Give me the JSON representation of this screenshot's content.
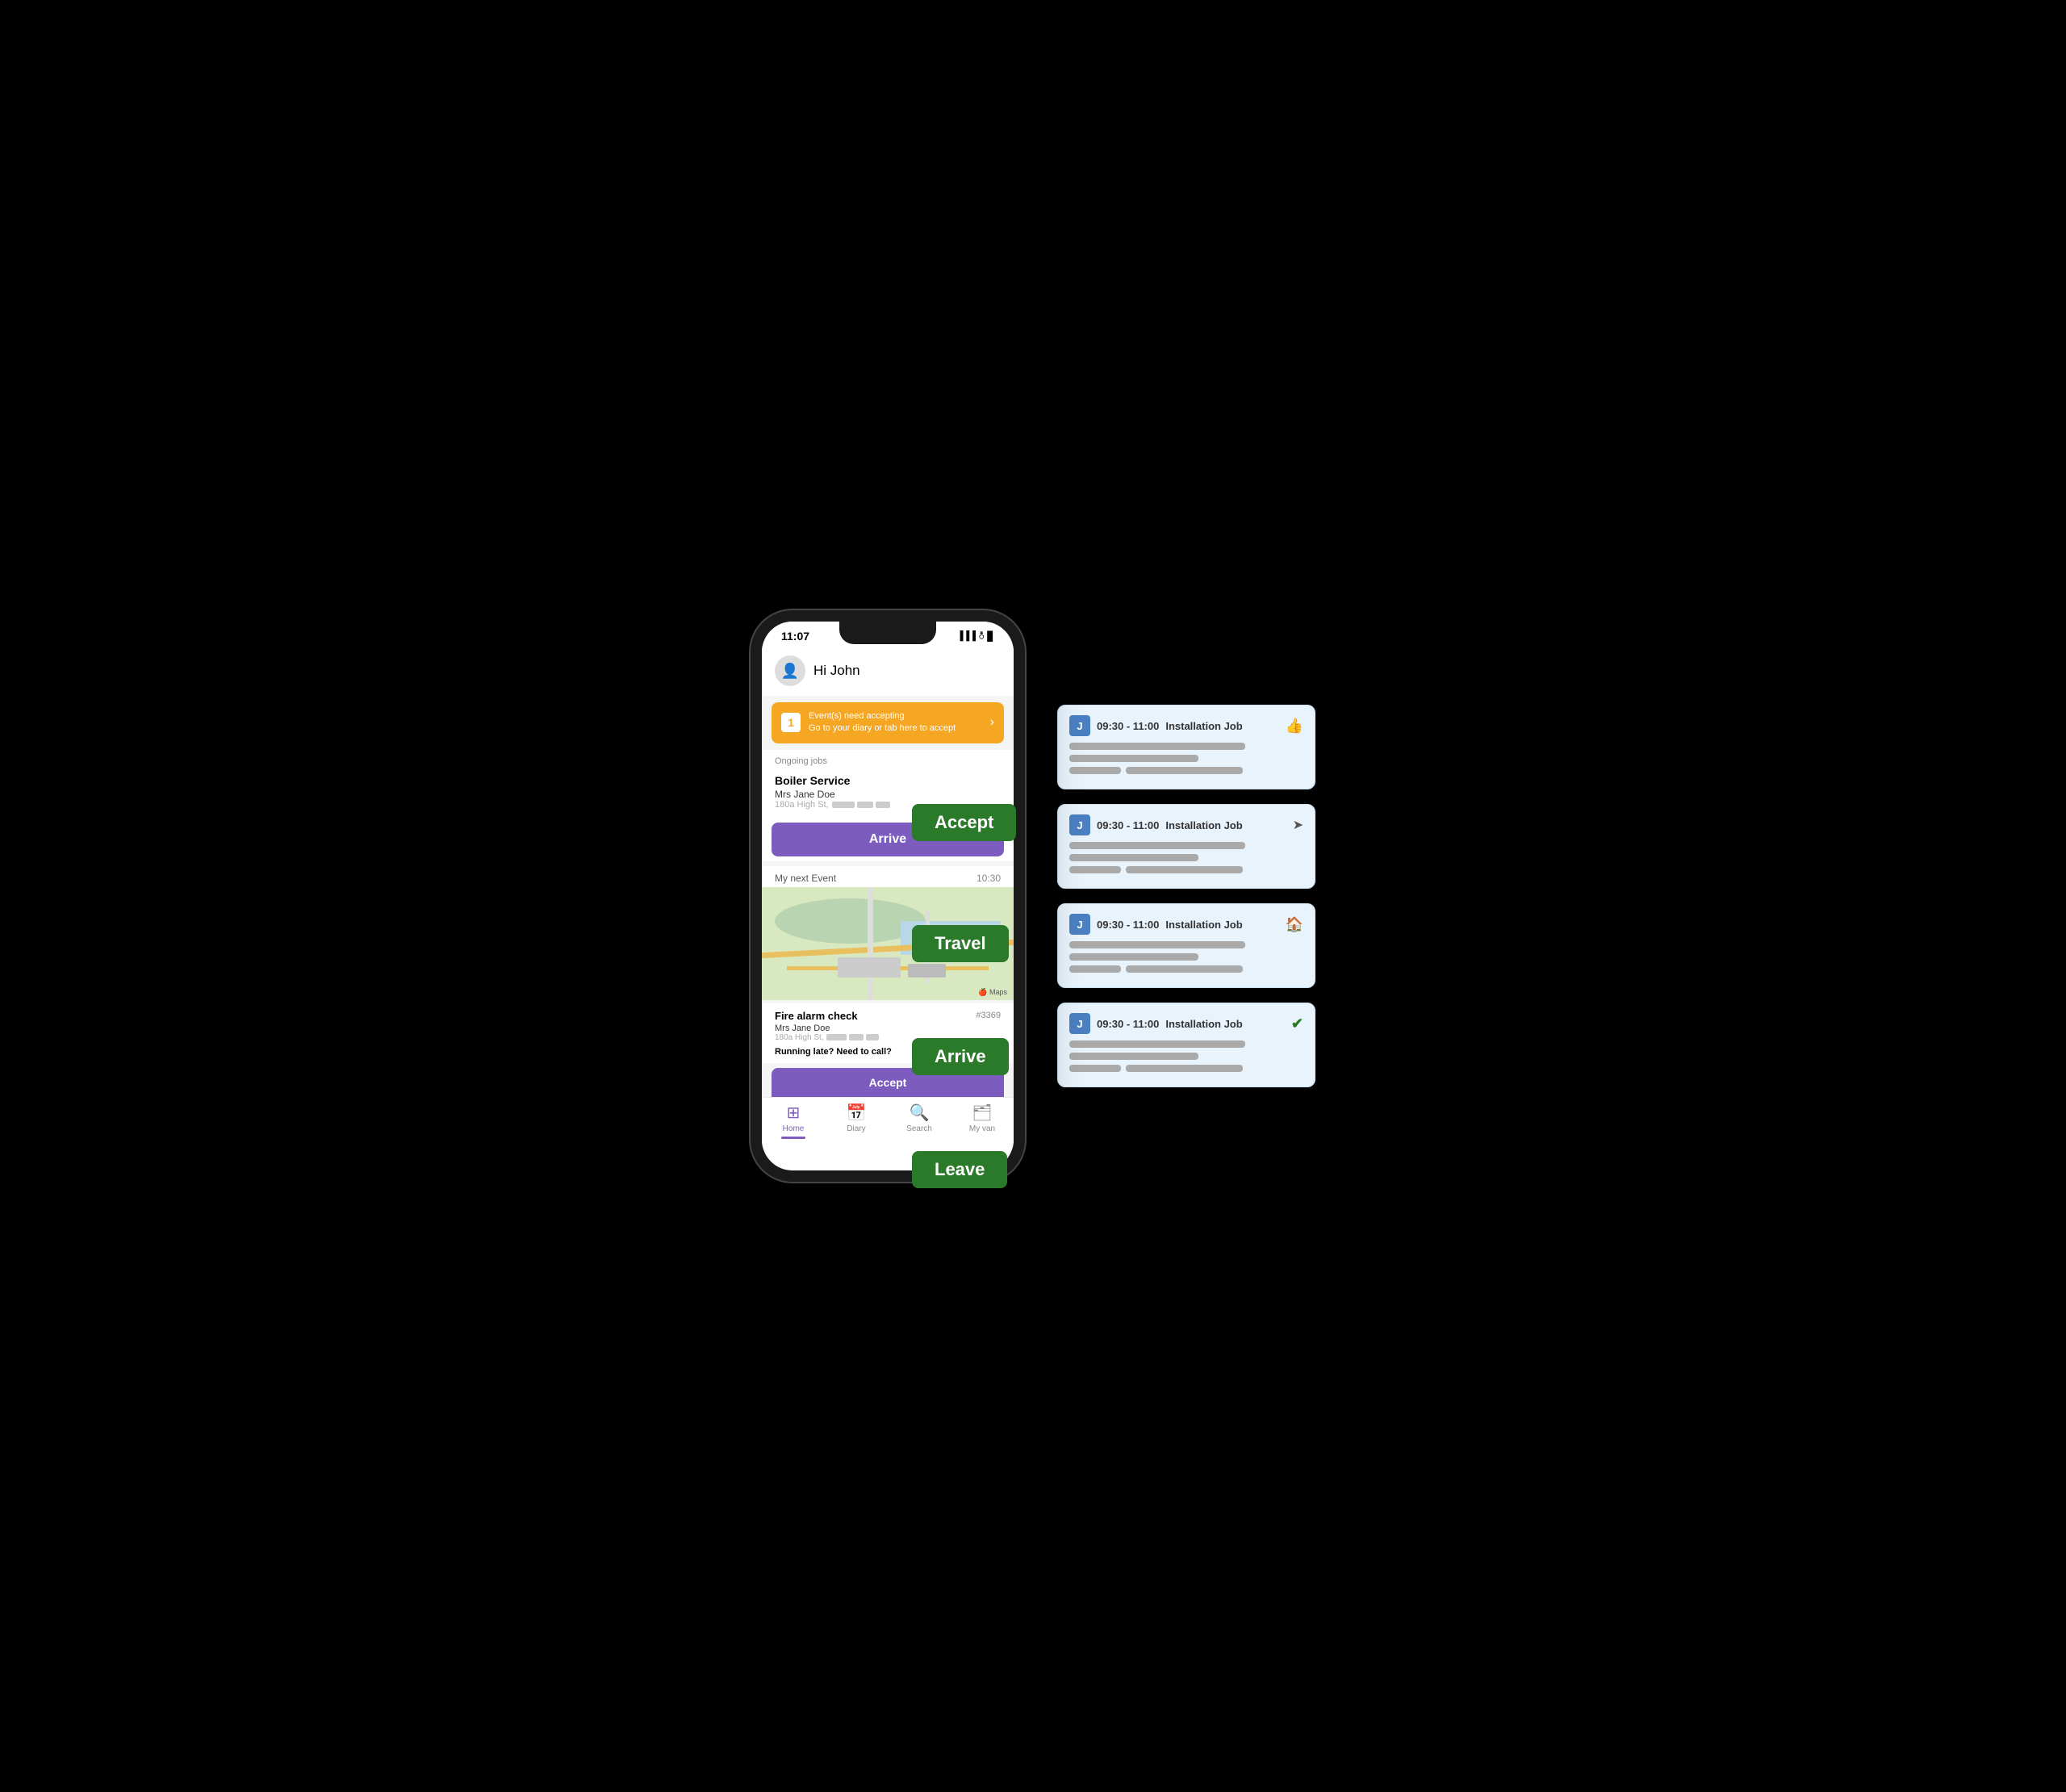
{
  "status_bar": {
    "time": "11:07",
    "icons": "▐▐▐ ᵯ ▊"
  },
  "greeting": "Hi John",
  "notification": {
    "count": "1",
    "line1": "Event(s) need accepting",
    "line2": "Go to your diary or tab here to accept"
  },
  "ongoing_label": "Ongoing jobs",
  "job1": {
    "title": "Boiler Service",
    "customer": "Mrs Jane Doe",
    "address": "180a High St,"
  },
  "arrive_button": "Arrive",
  "next_event_label": "My next Event",
  "next_event_time": "10:30",
  "map_label": "Maps",
  "job2": {
    "title": "Fire alarm check",
    "id": "#3369",
    "customer": "Mrs Jane Doe",
    "address": "180a High St,",
    "running_late": "Running late? Need to call?"
  },
  "accept_button_partial": "Accept",
  "tabs": [
    {
      "id": "home",
      "label": "Home",
      "icon": "⊞",
      "active": true
    },
    {
      "id": "diary",
      "label": "Diary",
      "icon": "📅",
      "active": false
    },
    {
      "id": "search",
      "label": "Search",
      "icon": "🔍",
      "active": false
    },
    {
      "id": "myvan",
      "label": "My van",
      "icon": "🗂",
      "active": false
    }
  ],
  "action_labels": {
    "accept": "Accept",
    "travel": "Travel",
    "arrive": "Arrive",
    "leave": "Leave"
  },
  "event_cards": [
    {
      "avatar": "J",
      "time": "09:30 - 11:00",
      "title": "Installation Job",
      "icon_type": "thumbs",
      "icon_char": "👍"
    },
    {
      "avatar": "J",
      "time": "09:30 - 11:00",
      "title": "Installation Job",
      "icon_type": "travel",
      "icon_char": "➤"
    },
    {
      "avatar": "J",
      "time": "09:30 - 11:00",
      "title": "Installation Job",
      "icon_type": "home",
      "icon_char": "🏠"
    },
    {
      "avatar": "J",
      "time": "09:30 - 11:00",
      "title": "Installation Job",
      "icon_type": "check",
      "icon_char": "✔"
    }
  ],
  "colors": {
    "purple": "#7c5cbf",
    "orange": "#f5a623",
    "green": "#2a7a2a",
    "card_bg": "#e8f3fc",
    "avatar_bg": "#4a7fc1"
  }
}
